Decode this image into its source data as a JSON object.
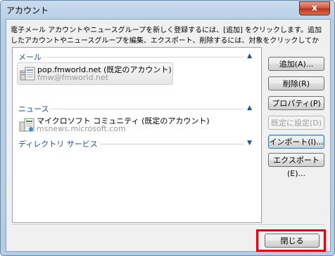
{
  "window": {
    "title": "アカウント",
    "close_glyph": "x"
  },
  "description": "電子メール アカウントやニュースグループを新しく登録するには、[追加] をクリックします。追加したアカウントやニュースグループを編集、エクスポート、削除するには、対象をクリックしてから、希望の動作をクリックします。",
  "groups": {
    "mail": {
      "label": "メール",
      "items": [
        {
          "name": "pop.fmworld.net (既定のアカウント)",
          "address": "fmw@fmworld.net"
        }
      ]
    },
    "news": {
      "label": "ニュース",
      "items": [
        {
          "name": "マイクロソフト コミュニティ (既定のアカウント)",
          "address": "msnews.microsoft.com"
        }
      ]
    },
    "directory": {
      "label": "ディレクトリ サービス"
    }
  },
  "buttons": {
    "add": "追加(A)...",
    "remove": "削除(R)",
    "properties": "プロパティ(P)",
    "set_default": "既定に設定(D)",
    "import": "インポート(I)...",
    "export": "エクスポート(E)...",
    "close": "閉じる"
  },
  "colors": {
    "group_label": "#1e50a2",
    "highlight": "#e60012"
  }
}
